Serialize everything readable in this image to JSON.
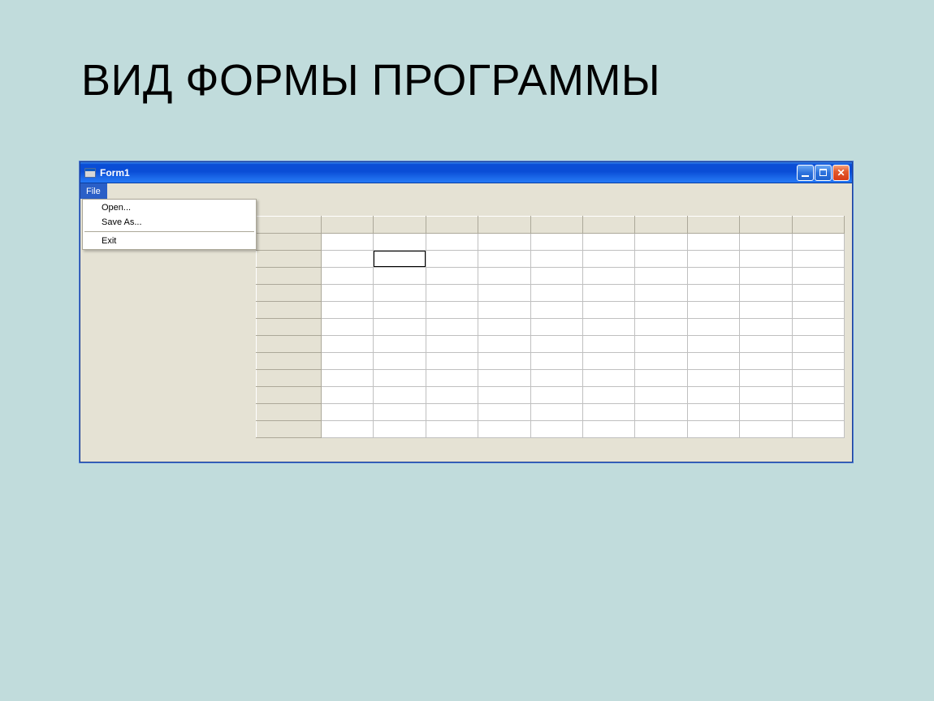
{
  "slide": {
    "title": "ВИД ФОРМЫ ПРОГРАММЫ"
  },
  "window": {
    "title": "Form1",
    "controls": {
      "minimize": "Minimize",
      "maximize": "Maximize",
      "close": "Close"
    }
  },
  "menubar": {
    "file": "File"
  },
  "file_menu": {
    "open": "Open...",
    "save_as": "Save As...",
    "exit": "Exit"
  },
  "grid": {
    "columns": 10,
    "rows": 12,
    "selected": {
      "row": 1,
      "col": 1
    }
  }
}
